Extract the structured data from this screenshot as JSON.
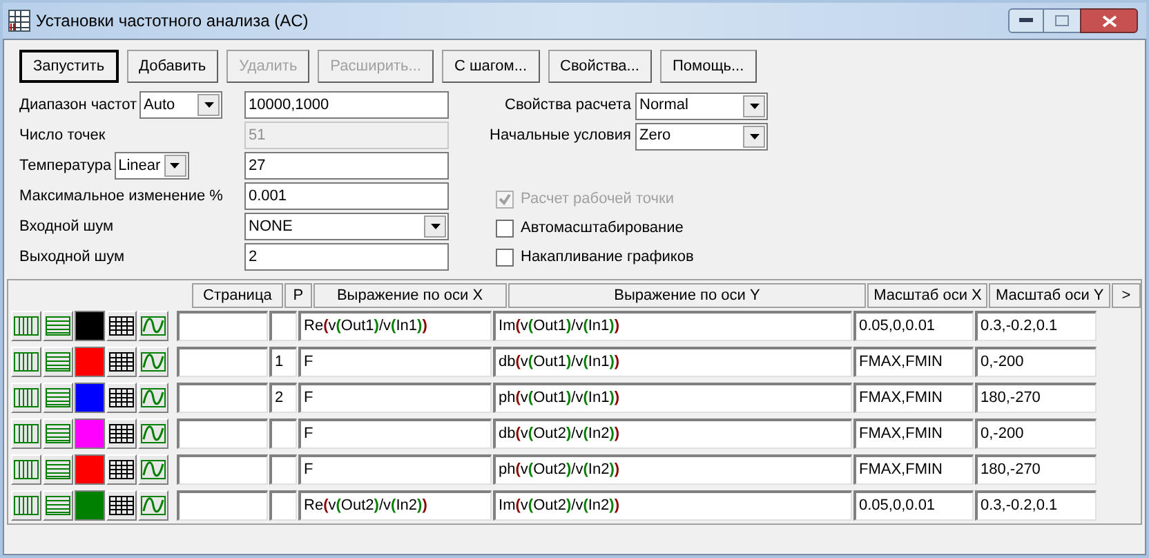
{
  "window": {
    "title": "Установки частотного анализа (AC)"
  },
  "buttons": [
    {
      "label": "Запустить",
      "disabled": false,
      "default": true
    },
    {
      "label": "Добавить",
      "disabled": false,
      "default": false
    },
    {
      "label": "Удалить",
      "disabled": true,
      "default": false
    },
    {
      "label": "Расширить...",
      "disabled": true,
      "default": false
    },
    {
      "label": "С шагом...",
      "disabled": false,
      "default": false
    },
    {
      "label": "Свойства...",
      "disabled": false,
      "default": false
    },
    {
      "label": "Помощь...",
      "disabled": false,
      "default": false
    }
  ],
  "fields": [
    {
      "label": "Диапазон частот",
      "mode": "Auto",
      "value": "10000,1000",
      "kind": "text",
      "disabled": false
    },
    {
      "label": "Число точек",
      "value": "51",
      "kind": "text",
      "disabled": true
    },
    {
      "label": "Температура",
      "mode": "Linear",
      "value": "27",
      "kind": "text",
      "disabled": false
    },
    {
      "label": "Максимальное изменение %",
      "value": "0.001",
      "kind": "text",
      "disabled": false
    },
    {
      "label": "Входной шум",
      "value": "NONE",
      "kind": "select",
      "disabled": false
    },
    {
      "label": "Выходной шум",
      "value": "2",
      "kind": "text",
      "disabled": false
    }
  ],
  "options": [
    {
      "label": "Свойства расчета",
      "value": "Normal"
    },
    {
      "label": "Начальные условия",
      "value": "Zero"
    }
  ],
  "checkboxes": [
    {
      "label": "Расчет рабочей точки",
      "checked": true,
      "disabled": true
    },
    {
      "label": "Автомасштабирование",
      "checked": false,
      "disabled": false
    },
    {
      "label": "Накапливание графиков",
      "checked": false,
      "disabled": false
    }
  ],
  "table": {
    "columns": [
      "Страница",
      "P",
      "Выражение по оси X",
      "Выражение по оси Y",
      "Масштаб оси X",
      "Масштаб оси Y"
    ],
    "more": ">",
    "rows": [
      {
        "color": "#000000",
        "page": "",
        "p": "",
        "x": "Re(v(Out1)/v(In1))",
        "y": "Im(v(Out1)/v(In1))",
        "xs": "0.05,0,0.01",
        "ys": "0.3,-0.2,0.1"
      },
      {
        "color": "#ff0000",
        "page": "",
        "p": "1",
        "x": "F",
        "y": "db(v(Out1)/v(In1))",
        "xs": "FMAX,FMIN",
        "ys": "0,-200"
      },
      {
        "color": "#0000ff",
        "page": "",
        "p": "2",
        "x": "F",
        "y": "ph(v(Out1)/v(In1))",
        "xs": "FMAX,FMIN",
        "ys": "180,-270"
      },
      {
        "color": "#ff00ff",
        "page": "",
        "p": "",
        "x": "F",
        "y": "db(v(Out2)/v(In2))",
        "xs": "FMAX,FMIN",
        "ys": "0,-200"
      },
      {
        "color": "#ff0000",
        "page": "",
        "p": "",
        "x": "F",
        "y": "ph(v(Out2)/v(In2))",
        "xs": "FMAX,FMIN",
        "ys": "180,-270"
      },
      {
        "color": "#008000",
        "page": "",
        "p": "",
        "x": "Re(v(Out2)/v(In2))",
        "y": "Im(v(Out2)/v(In2))",
        "xs": "0.05,0,0.01",
        "ys": "0.3,-0.2,0.1"
      }
    ]
  }
}
